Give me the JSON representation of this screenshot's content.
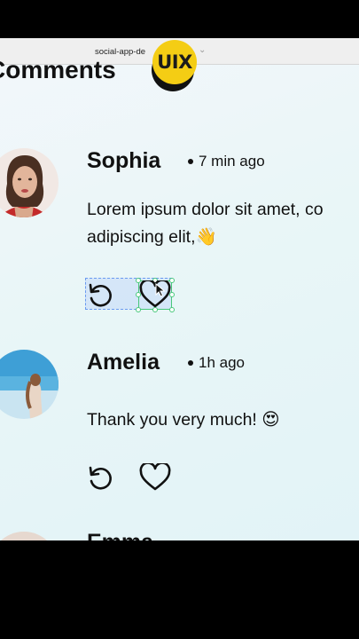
{
  "browser": {
    "tab_title": "social-app-de",
    "chevron": "⌄"
  },
  "badge": {
    "label": "UIX"
  },
  "page": {
    "heading": "Comments"
  },
  "comments": [
    {
      "author": "Sophia",
      "time": "7 min ago",
      "lines": [
        "Lorem ipsum dolor sit amet, co",
        "adipiscing elit,👋"
      ]
    },
    {
      "author": "Amelia",
      "time": "1h ago",
      "lines": [
        "Thank you very much! 😍"
      ]
    },
    {
      "author": "Emma"
    }
  ],
  "icons": {
    "reply": "reply-icon",
    "like": "heart-icon",
    "cursor": "mouse-cursor-icon"
  }
}
